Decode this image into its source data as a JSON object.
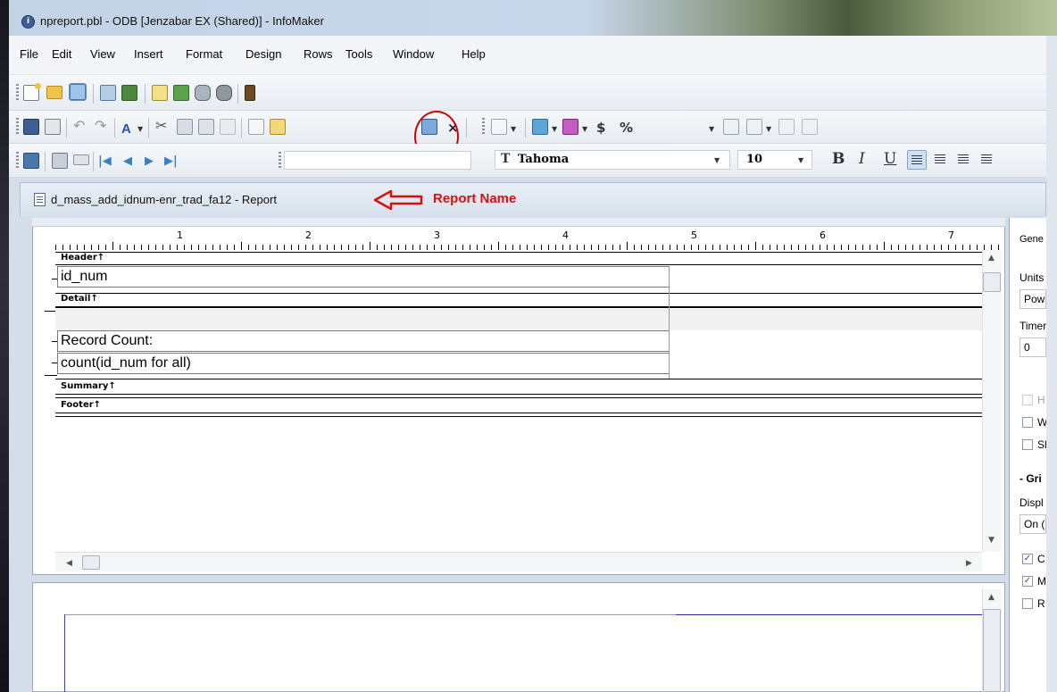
{
  "window": {
    "title": "npreport.pbl - ODB [Jenzabar EX (Shared)] - InfoMaker",
    "app_icon": "infomaker-icon"
  },
  "menu": [
    "File",
    "Edit",
    "View",
    "Insert",
    "Format",
    "Design",
    "Rows",
    "Tools",
    "Window",
    "Help"
  ],
  "toolbar_format": {
    "font_name": "Tahoma",
    "font_size": "10",
    "font_icon_text": "T",
    "currency": "$",
    "percent": "%",
    "bold": "B",
    "italic": "I",
    "underline": "U",
    "text_button": "A",
    "delete_mark": "×"
  },
  "report_window": {
    "title": "d_mass_add_idnum-enr_trad_fa12 - Report"
  },
  "annotation": {
    "text": "Report Name",
    "color": "#d81010"
  },
  "ruler": {
    "numbers": [
      "1",
      "2",
      "3",
      "4",
      "5",
      "6",
      "7"
    ]
  },
  "bands": {
    "header": "Header↑",
    "detail": "Detail↑",
    "summary": "Summary↑",
    "footer": "Footer↑"
  },
  "controls": {
    "id_num": "id_num",
    "record_count": "Record Count:",
    "count_expr": "count(id_num for all)"
  },
  "properties": {
    "general": "Gene",
    "units_label": "Units",
    "units_value": "Pow",
    "timer_label": "Timer",
    "timer_value": "0",
    "chk_h": "H",
    "chk_w": "W",
    "chk_s": "Sl",
    "grid_section": "- Gri",
    "display_label": "Displ",
    "display_value": "On (",
    "chk_c": "C",
    "chk_m": "M",
    "chk_r": "R"
  }
}
